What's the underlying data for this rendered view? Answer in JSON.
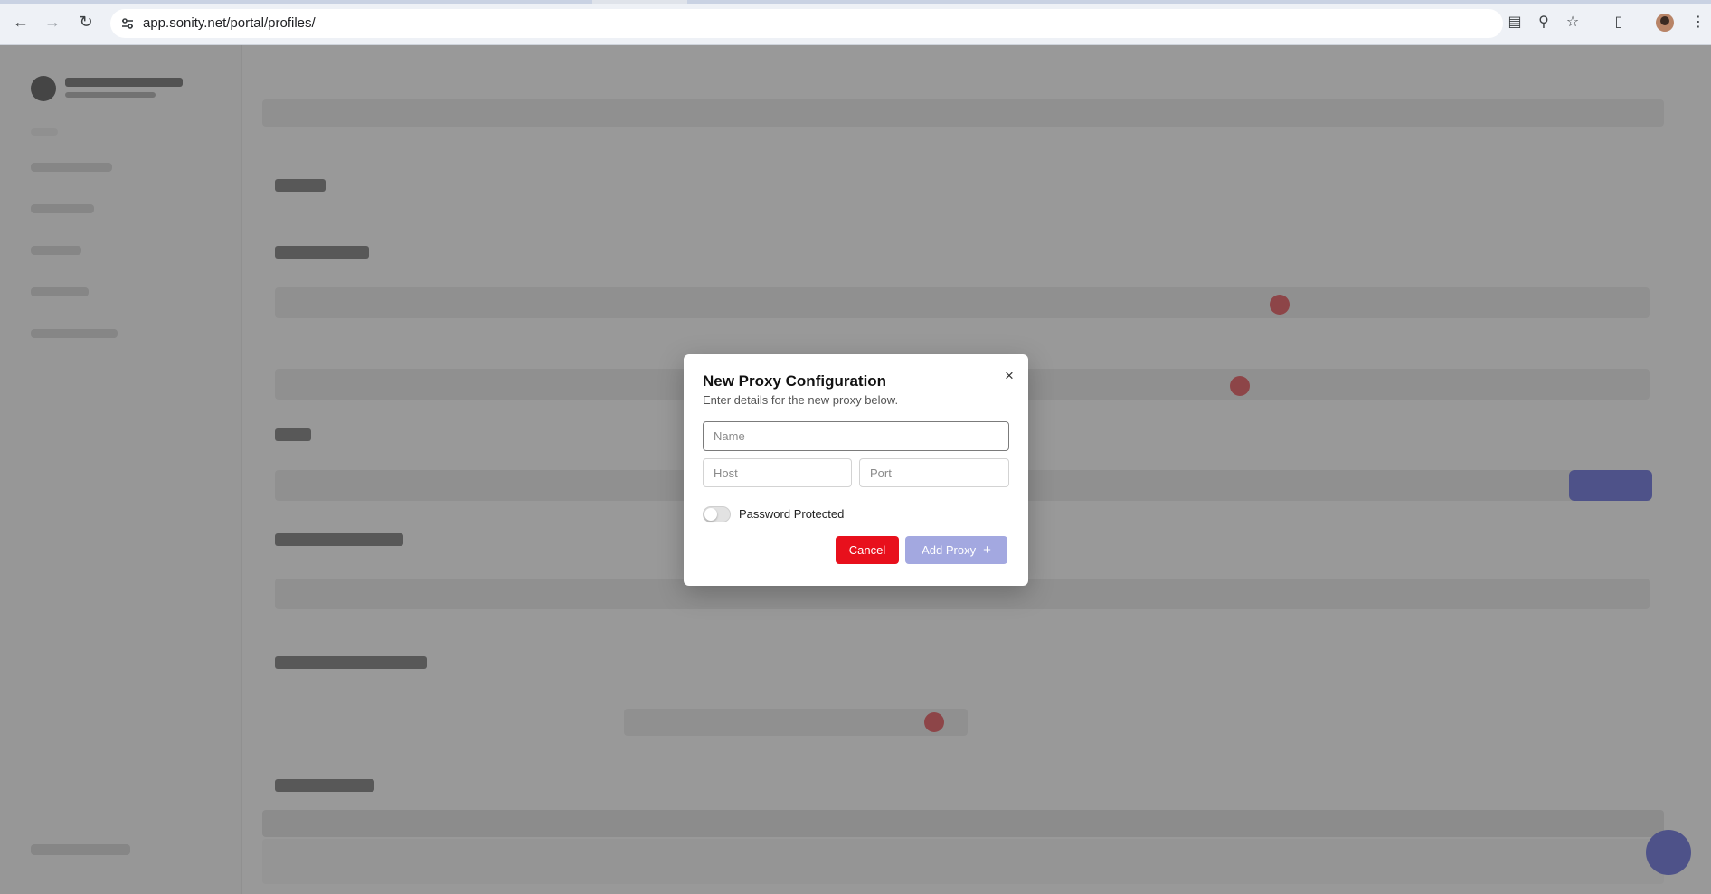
{
  "browser": {
    "url": "app.sonity.net/portal/profiles/",
    "icons": [
      "back-icon",
      "forward-icon",
      "reload-icon",
      "site-settings-icon",
      "install-app-icon",
      "zoom-icon",
      "bookmark-star-icon",
      "extensions-icon",
      "profile-avatar",
      "more-menu-icon"
    ]
  },
  "modal": {
    "title": "New Proxy Configuration",
    "subtitle": "Enter details for the new proxy below.",
    "name_placeholder": "Name",
    "host_placeholder": "Host",
    "port_placeholder": "Port",
    "password_toggle_label": "Password Protected",
    "password_toggle_on": false,
    "cancel_label": "Cancel",
    "add_label": "Add Proxy",
    "add_icon": "+",
    "close_icon": "×"
  },
  "colors": {
    "cancel": "#e8101c",
    "add_disabled": "#a3a8e0",
    "accent": "#3b46d6"
  }
}
